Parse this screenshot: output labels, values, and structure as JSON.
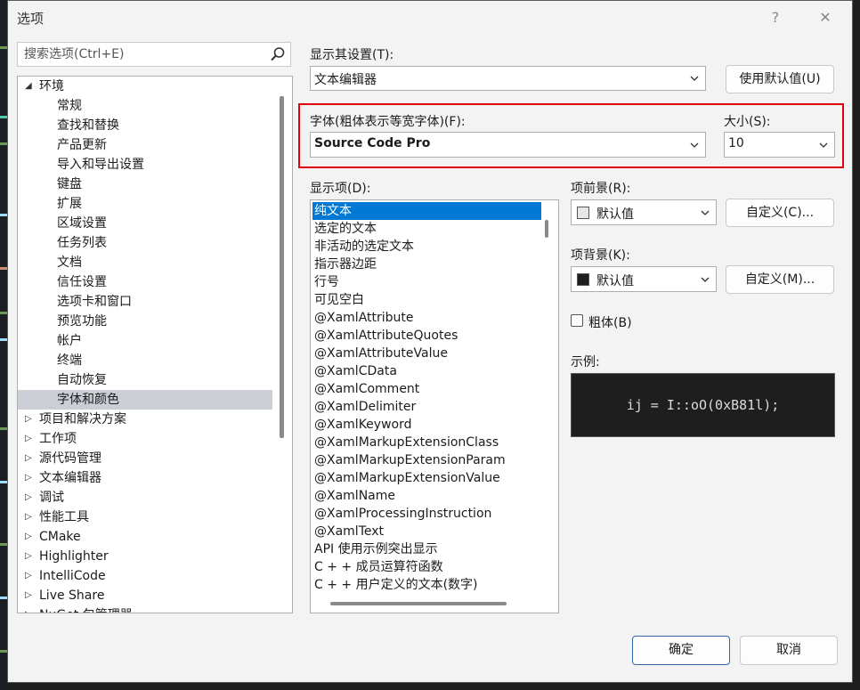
{
  "dialog": {
    "title": "选项",
    "help_glyph": "?",
    "close_glyph": "✕"
  },
  "search": {
    "placeholder": "搜索选项(Ctrl+E)"
  },
  "tree": {
    "items": [
      {
        "label": "环境",
        "expanded": true,
        "level": 0,
        "selected": false
      },
      {
        "label": "常规",
        "level": 1,
        "selected": false
      },
      {
        "label": "查找和替换",
        "level": 1,
        "selected": false
      },
      {
        "label": "产品更新",
        "level": 1,
        "selected": false
      },
      {
        "label": "导入和导出设置",
        "level": 1,
        "selected": false
      },
      {
        "label": "键盘",
        "level": 1,
        "selected": false
      },
      {
        "label": "扩展",
        "level": 1,
        "selected": false
      },
      {
        "label": "区域设置",
        "level": 1,
        "selected": false
      },
      {
        "label": "任务列表",
        "level": 1,
        "selected": false
      },
      {
        "label": "文档",
        "level": 1,
        "selected": false
      },
      {
        "label": "信任设置",
        "level": 1,
        "selected": false
      },
      {
        "label": "选项卡和窗口",
        "level": 1,
        "selected": false
      },
      {
        "label": "预览功能",
        "level": 1,
        "selected": false
      },
      {
        "label": "帐户",
        "level": 1,
        "selected": false
      },
      {
        "label": "终端",
        "level": 1,
        "selected": false
      },
      {
        "label": "自动恢复",
        "level": 1,
        "selected": false
      },
      {
        "label": "字体和颜色",
        "level": 1,
        "selected": true
      },
      {
        "label": "项目和解决方案",
        "expanded": false,
        "level": 0,
        "selected": false
      },
      {
        "label": "工作项",
        "expanded": false,
        "level": 0,
        "selected": false
      },
      {
        "label": "源代码管理",
        "expanded": false,
        "level": 0,
        "selected": false
      },
      {
        "label": "文本编辑器",
        "expanded": false,
        "level": 0,
        "selected": false
      },
      {
        "label": "调试",
        "expanded": false,
        "level": 0,
        "selected": false
      },
      {
        "label": "性能工具",
        "expanded": false,
        "level": 0,
        "selected": false
      },
      {
        "label": "CMake",
        "expanded": false,
        "level": 0,
        "selected": false
      },
      {
        "label": "Highlighter",
        "expanded": false,
        "level": 0,
        "selected": false
      },
      {
        "label": "IntelliCode",
        "expanded": false,
        "level": 0,
        "selected": false
      },
      {
        "label": "Live Share",
        "expanded": false,
        "level": 0,
        "selected": false
      },
      {
        "label": "NuGet 包管理器",
        "expanded": false,
        "level": 0,
        "selected": false
      }
    ]
  },
  "settings_for": {
    "label": "显示其设置(T):",
    "value": "文本编辑器"
  },
  "use_defaults_button": "使用默认值(U)",
  "font": {
    "label": "字体(粗体表示等宽字体)(F):",
    "value": "Source Code Pro"
  },
  "size": {
    "label": "大小(S):",
    "value": "10"
  },
  "display_items": {
    "label": "显示项(D):",
    "items": [
      "纯文本",
      "选定的文本",
      "非活动的选定文本",
      "指示器边距",
      "行号",
      "可见空白",
      "@XamlAttribute",
      "@XamlAttributeQuotes",
      "@XamlAttributeValue",
      "@XamlCData",
      "@XamlComment",
      "@XamlDelimiter",
      "@XamlKeyword",
      "@XamlMarkupExtensionClass",
      "@XamlMarkupExtensionParam",
      "@XamlMarkupExtensionValue",
      "@XamlName",
      "@XamlProcessingInstruction",
      "@XamlText",
      "API 使用示例突出显示",
      "C + + 成员运算符函数",
      "C + + 用户定义的文本(数字)"
    ],
    "selected_index": 0
  },
  "foreground": {
    "label": "项前景(R):",
    "value": "默认值",
    "swatch_color": "#e6e6e6",
    "custom_button": "自定义(C)..."
  },
  "background": {
    "label": "项背景(K):",
    "value": "默认值",
    "swatch_color": "#1e1e1e",
    "custom_button": "自定义(M)..."
  },
  "bold": {
    "label": "粗体(B)",
    "checked": false
  },
  "sample": {
    "label": "示例:",
    "text": "ij = I::oO(0xB81l);"
  },
  "footer": {
    "ok": "确定",
    "cancel": "取消"
  },
  "colors": {
    "selection_blue": "#0078d4",
    "highlight_red": "#e0000f",
    "tree_selection": "#ccced6"
  }
}
